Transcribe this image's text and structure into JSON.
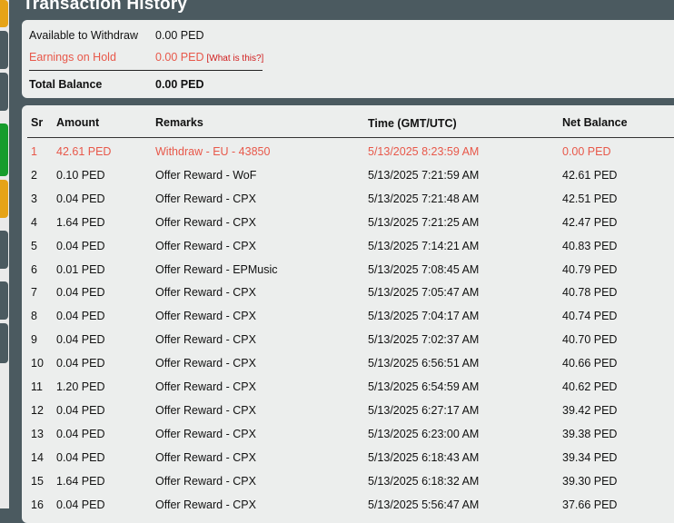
{
  "page": {
    "title": "Transaction History"
  },
  "summary": {
    "available": {
      "label": "Available to Withdraw",
      "value": "0.00 PED"
    },
    "hold": {
      "label": "Earnings on Hold",
      "value": "0.00 PED",
      "link": "[What is this?]"
    },
    "total": {
      "label": "Total Balance",
      "value": "0.00 PED"
    }
  },
  "table": {
    "headers": [
      "Sr",
      "Amount",
      "Remarks",
      "Time (GMT/UTC)",
      "Net Balance"
    ],
    "rows": [
      [
        "1",
        "42.61 PED",
        "Withdraw - EU - 43850",
        "5/13/2025 8:23:59 AM",
        "0.00 PED"
      ],
      [
        "2",
        "0.10 PED",
        "Offer Reward - WoF",
        "5/13/2025 7:21:59 AM",
        "42.61 PED"
      ],
      [
        "3",
        "0.04 PED",
        "Offer Reward - CPX",
        "5/13/2025 7:21:48 AM",
        "42.51 PED"
      ],
      [
        "4",
        "1.64 PED",
        "Offer Reward - CPX",
        "5/13/2025 7:21:25 AM",
        "42.47 PED"
      ],
      [
        "5",
        "0.04 PED",
        "Offer Reward - CPX",
        "5/13/2025 7:14:21 AM",
        "40.83 PED"
      ],
      [
        "6",
        "0.01 PED",
        "Offer Reward - EPMusic",
        "5/13/2025 7:08:45 AM",
        "40.79 PED"
      ],
      [
        "7",
        "0.04 PED",
        "Offer Reward - CPX",
        "5/13/2025 7:05:47 AM",
        "40.78 PED"
      ],
      [
        "8",
        "0.04 PED",
        "Offer Reward - CPX",
        "5/13/2025 7:04:17 AM",
        "40.74 PED"
      ],
      [
        "9",
        "0.04 PED",
        "Offer Reward - CPX",
        "5/13/2025 7:02:37 AM",
        "40.70 PED"
      ],
      [
        "10",
        "0.04 PED",
        "Offer Reward - CPX",
        "5/13/2025 6:56:51 AM",
        "40.66 PED"
      ],
      [
        "11",
        "1.20 PED",
        "Offer Reward - CPX",
        "5/13/2025 6:54:59 AM",
        "40.62 PED"
      ],
      [
        "12",
        "0.04 PED",
        "Offer Reward - CPX",
        "5/13/2025 6:27:17 AM",
        "39.42 PED"
      ],
      [
        "13",
        "0.04 PED",
        "Offer Reward - CPX",
        "5/13/2025 6:23:00 AM",
        "39.38 PED"
      ],
      [
        "14",
        "0.04 PED",
        "Offer Reward - CPX",
        "5/13/2025 6:18:43 AM",
        "39.34 PED"
      ],
      [
        "15",
        "1.64 PED",
        "Offer Reward - CPX",
        "5/13/2025 6:18:32 AM",
        "39.30 PED"
      ],
      [
        "16",
        "0.04 PED",
        "Offer Reward - CPX",
        "5/13/2025 5:56:47 AM",
        "37.66 PED"
      ]
    ]
  },
  "colors": {
    "highlight": "#e8584a",
    "background": "#4b5a60",
    "panel": "#eceeed"
  }
}
